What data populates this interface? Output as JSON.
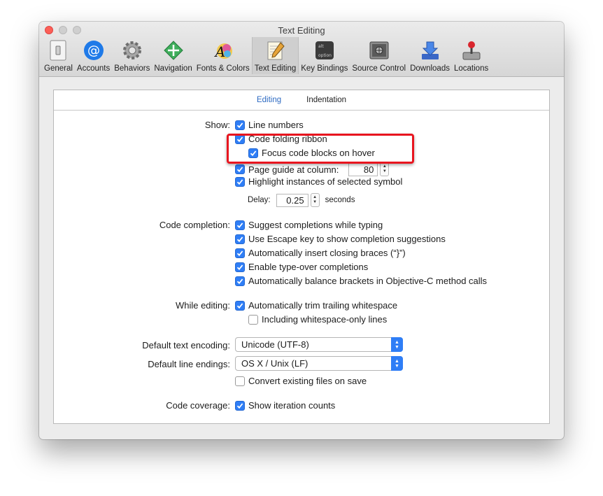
{
  "window": {
    "title": "Text Editing"
  },
  "toolbar": {
    "items": [
      {
        "label": "General",
        "icon": "switch-icon"
      },
      {
        "label": "Accounts",
        "icon": "at-sign-icon"
      },
      {
        "label": "Behaviors",
        "icon": "gear-icon"
      },
      {
        "label": "Navigation",
        "icon": "navigation-arrows-icon"
      },
      {
        "label": "Fonts & Colors",
        "icon": "font-palette-icon"
      },
      {
        "label": "Text Editing",
        "icon": "notepad-pencil-icon"
      },
      {
        "label": "Key Bindings",
        "icon": "keyboard-keys-icon"
      },
      {
        "label": "Source Control",
        "icon": "safe-icon"
      },
      {
        "label": "Downloads",
        "icon": "download-arrow-icon"
      },
      {
        "label": "Locations",
        "icon": "joystick-icon"
      }
    ],
    "active": "Text Editing"
  },
  "tabs": {
    "editing": "Editing",
    "indentation": "Indentation"
  },
  "show": {
    "label": "Show:",
    "line_numbers": "Line numbers",
    "code_folding": "Code folding ribbon",
    "focus_blocks": "Focus code blocks on hover",
    "page_guide": "Page guide at column:",
    "page_guide_value": "80",
    "highlight": "Highlight instances of selected symbol",
    "delay_label": "Delay:",
    "delay_value": "0.25",
    "delay_unit": "seconds"
  },
  "completion": {
    "label": "Code completion:",
    "suggest": "Suggest completions while typing",
    "escape": "Use Escape key to show completion suggestions",
    "braces": "Automatically insert closing braces (“}”)",
    "typeover": "Enable type-over completions",
    "balance": "Automatically balance brackets in Objective-C method calls"
  },
  "editing": {
    "label": "While editing:",
    "trim": "Automatically trim trailing whitespace",
    "whitespace_only": "Including whitespace-only lines"
  },
  "encoding": {
    "label": "Default text encoding:",
    "value": "Unicode (UTF-8)"
  },
  "line_endings": {
    "label": "Default line endings:",
    "value": "OS X / Unix (LF)",
    "convert": "Convert existing files on save"
  },
  "coverage": {
    "label": "Code coverage:",
    "iteration": "Show iteration counts"
  },
  "colors": {
    "accent": "#2f7ef6",
    "highlight_box": "#e8151f"
  }
}
